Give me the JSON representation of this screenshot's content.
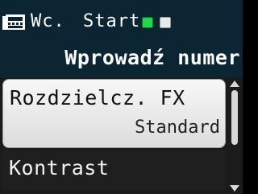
{
  "header": {
    "fax_icon": "fax-machine-icon",
    "mode_label": "Wc.",
    "start_label": "Start",
    "status_led_colors": [
      "#21d64a",
      "#eaeaea"
    ],
    "prompt": "Wprowadź numer"
  },
  "menu": {
    "items": [
      {
        "label": "Rozdzielcz. FX",
        "value": "Standard",
        "selected": true
      },
      {
        "label": "Kontrast"
      }
    ]
  },
  "scrollbar": {
    "up_icon": "scroll-up-arrow-icon",
    "down_icon": "scroll-down-arrow-icon"
  }
}
